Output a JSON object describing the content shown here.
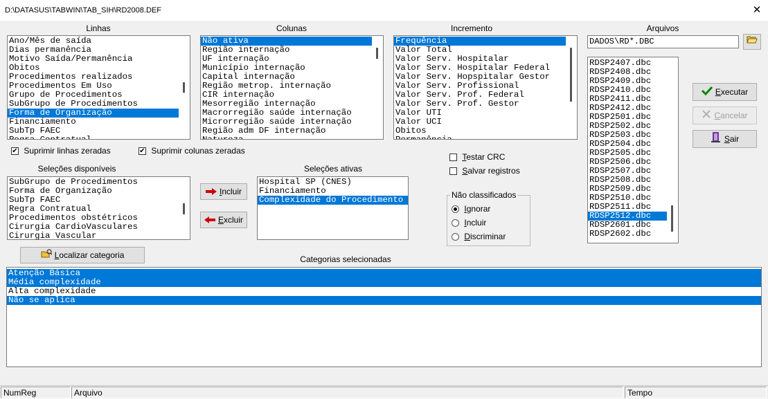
{
  "window": {
    "title": "D:\\DATASUS\\TABWIN\\TAB_SIH\\RD2008.DEF",
    "close_glyph": "✕"
  },
  "linhas": {
    "label": "Linhas",
    "items": [
      "Ano/Mês de saída",
      "Dias permanência",
      "Motivo Saída/Permanência",
      "Óbitos",
      "Procedimentos realizados",
      "Procedimentos Em Uso",
      "Grupo de Procedimentos",
      "SubGrupo de Procedimentos",
      "Forma de Organização",
      "Financiamento",
      "SubTp FAEC",
      "Regra Contratual"
    ],
    "selected_index": 8
  },
  "colunas": {
    "label": "Colunas",
    "items": [
      "Não ativa",
      "Região internação",
      "UF internação",
      "Município internação",
      "Capital internação",
      "Região metrop. internação",
      "CIR internação",
      "Mesorregião internação",
      "Macrorregião saúde internação",
      "Microrregião saúde internação",
      "Região adm DF internação",
      "Natureza"
    ],
    "selected_index": 0
  },
  "incremento": {
    "label": "Incremento",
    "items": [
      "Frequência",
      "Valor Total",
      "Valor Serv. Hospitalar",
      "Valor Serv. Hospitalar Federal",
      "Valor Serv. Hopspitalar Gestor",
      "Valor Serv. Profissional",
      "Valor Serv. Prof. Federal",
      "Valor Serv. Prof. Gestor",
      "Valor UTI",
      "Valor UCI",
      "Óbitos",
      "Permanência"
    ],
    "selected_index": 0
  },
  "arquivos": {
    "label": "Arquivos",
    "pattern": "DADOS\\RD*.DBC",
    "files": [
      "RDSP2407.dbc",
      "RDSP2408.dbc",
      "RDSP2409.dbc",
      "RDSP2410.dbc",
      "RDSP2411.dbc",
      "RDSP2412.dbc",
      "RDSP2501.dbc",
      "RDSP2502.dbc",
      "RDSP2503.dbc",
      "RDSP2504.dbc",
      "RDSP2505.dbc",
      "RDSP2506.dbc",
      "RDSP2507.dbc",
      "RDSP2508.dbc",
      "RDSP2509.dbc",
      "RDSP2510.dbc",
      "RDSP2511.dbc",
      "RDSP2512.dbc",
      "RDSP2601.dbc",
      "RDSP2602.dbc"
    ],
    "selected_index": 17
  },
  "options": {
    "suprimir_linhas": {
      "label": "Suprimir linhas zeradas",
      "checked": true
    },
    "suprimir_colunas": {
      "label": "Suprimir colunas zeradas",
      "checked": true
    },
    "testar_crc": {
      "label_u": "T",
      "label_rest": "estar CRC",
      "checked": false
    },
    "salvar_registros": {
      "label_u": "S",
      "label_rest": "alvar registros",
      "checked": false
    }
  },
  "nao_classificados": {
    "label": "Não classificados",
    "options": [
      {
        "u": "I",
        "rest": "gnorar",
        "on": true
      },
      {
        "u": "I",
        "rest": "ncluir",
        "on": false
      },
      {
        "u": "D",
        "rest": "iscriminar",
        "on": false
      }
    ]
  },
  "selecoes_disponiveis": {
    "label": "Seleções disponíveis",
    "items": [
      "SubGrupo de Procedimentos",
      "Forma de Organização",
      "SubTp FAEC",
      "Regra Contratual",
      "Procedimentos obstétricos",
      "Cirurgia CardioVasculares",
      "Cirurgia Vascular"
    ]
  },
  "selecoes_ativas": {
    "label": "Seleções ativas",
    "items": [
      "Hospital SP (CNES)",
      "Financiamento",
      "Complexidade do Procedimento"
    ],
    "selected_index": 2
  },
  "buttons": {
    "incluir": {
      "u": "I",
      "rest": "ncluir"
    },
    "excluir": {
      "u": "E",
      "rest": "xcluir"
    },
    "executar": {
      "u": "E",
      "rest": "xecutar"
    },
    "cancelar": {
      "u": "C",
      "rest": "ancelar"
    },
    "sair": {
      "u": "S",
      "rest": "air"
    },
    "localizar": {
      "u": "L",
      "rest": "ocalizar categoria"
    }
  },
  "categorias": {
    "label": "Categorias selecionadas",
    "items": [
      {
        "text": "Atenção Básica",
        "sel": true
      },
      {
        "text": "Média complexidade",
        "sel": true
      },
      {
        "text": "Alta complexidade",
        "sel": false
      },
      {
        "text": "Não se aplica",
        "sel": true
      }
    ]
  },
  "status": {
    "numreg": "NumReg",
    "arquivo": "Arquivo",
    "tempo": "Tempo"
  },
  "colors": {
    "selection": "#0078d7",
    "execute_check": "#008a00",
    "arrow": "#cc0000"
  }
}
